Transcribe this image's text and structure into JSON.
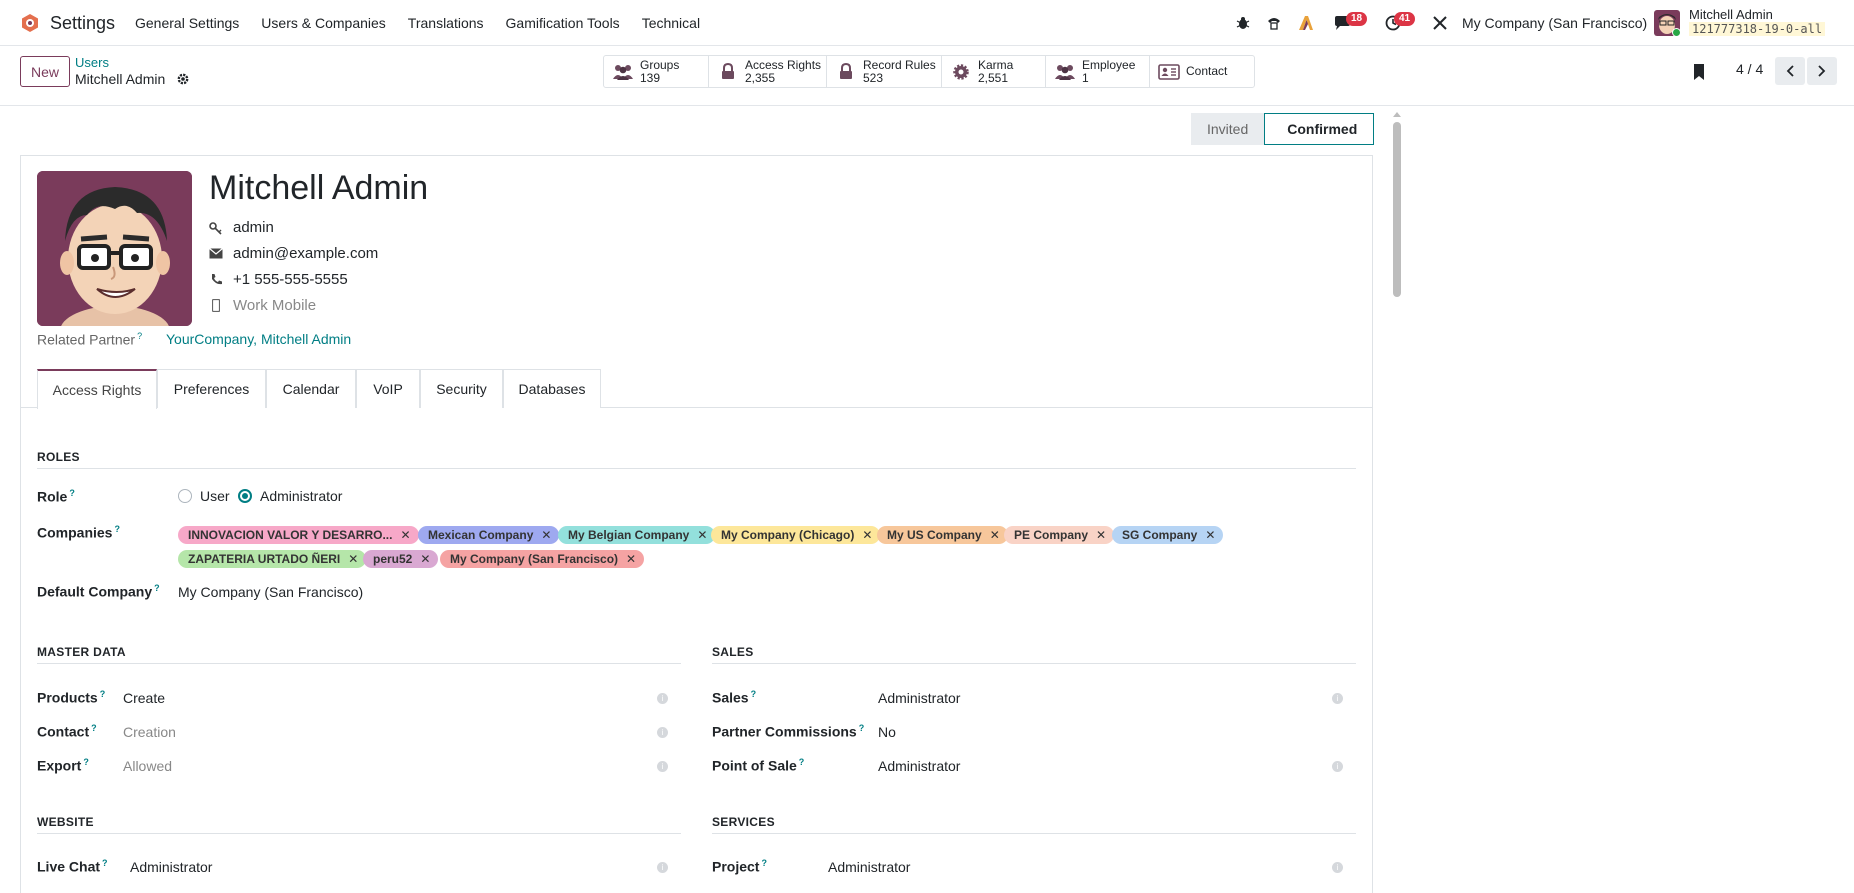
{
  "navbar": {
    "app_name": "Settings",
    "menu": [
      "General Settings",
      "Users & Companies",
      "Translations",
      "Gamification Tools",
      "Technical"
    ],
    "messages_badge": "18",
    "activities_badge": "41",
    "company": "My Company (San Francisco)",
    "user_name": "Mitchell Admin",
    "database": "121777318-19-0-all"
  },
  "control_panel": {
    "new_label": "New",
    "breadcrumb_parent": "Users",
    "breadcrumb_current": "Mitchell Admin",
    "smart_buttons": [
      {
        "label": "Groups",
        "value": "139",
        "icon": "users-icon"
      },
      {
        "label": "Access Rights",
        "value": "2,355",
        "icon": "lock-icon"
      },
      {
        "label": "Record Rules",
        "value": "523",
        "icon": "lock-icon"
      },
      {
        "label": "Karma",
        "value": "2,551",
        "icon": "karma-icon"
      },
      {
        "label": "Employee",
        "value": "1",
        "icon": "users-icon"
      },
      {
        "label": "Contact",
        "value": "",
        "icon": "contact-card-icon"
      }
    ],
    "pager": "4 / 4"
  },
  "statusbar": {
    "steps": [
      "Invited",
      "Confirmed"
    ],
    "current": "Confirmed"
  },
  "record": {
    "name": "Mitchell Admin",
    "login": "admin",
    "email": "admin@example.com",
    "phone": "+1 555-555-5555",
    "mobile_placeholder": "Work Mobile",
    "related_partner_label": "Related Partner",
    "related_partner": "YourCompany, Mitchell Admin"
  },
  "tabs": [
    "Access Rights",
    "Preferences",
    "Calendar",
    "VoIP",
    "Security",
    "Databases"
  ],
  "roles": {
    "section": "ROLES",
    "role_label": "Role",
    "role_options": [
      "User",
      "Administrator"
    ],
    "role_selected": "Administrator",
    "companies_label": "Companies",
    "companies": [
      {
        "name": "INNOVACION VALOR Y DESARRO...",
        "color": "#f7a8c8"
      },
      {
        "name": "Mexican Company",
        "color": "#9ea9f0"
      },
      {
        "name": "My Belgian Company",
        "color": "#93e0dc"
      },
      {
        "name": "My Company (Chicago)",
        "color": "#fde79a"
      },
      {
        "name": "My US Company",
        "color": "#f7c79b"
      },
      {
        "name": "PE Company",
        "color": "#f9d3c6"
      },
      {
        "name": "SG Company",
        "color": "#b6d4f4"
      },
      {
        "name": "ZAPATERIA URTADO ÑERI",
        "color": "#b5e6a9"
      },
      {
        "name": "peru52",
        "color": "#d9a8d2"
      },
      {
        "name": "My Company (San Francisco)",
        "color": "#f5a3a3"
      }
    ],
    "default_company_label": "Default Company",
    "default_company": "My Company (San Francisco)"
  },
  "master_data": {
    "section": "MASTER DATA",
    "rows": [
      {
        "label": "Products",
        "value": "Create",
        "muted": false
      },
      {
        "label": "Contact",
        "value": "Creation",
        "muted": true
      },
      {
        "label": "Export",
        "value": "Allowed",
        "muted": true
      }
    ]
  },
  "sales": {
    "section": "SALES",
    "rows": [
      {
        "label": "Sales",
        "value": "Administrator"
      },
      {
        "label": "Partner Commissions",
        "value": "No"
      },
      {
        "label": "Point of Sale",
        "value": "Administrator"
      }
    ]
  },
  "website": {
    "section": "WEBSITE",
    "rows": [
      {
        "label": "Live Chat",
        "value": "Administrator"
      }
    ]
  },
  "services": {
    "section": "SERVICES",
    "rows": [
      {
        "label": "Project",
        "value": "Administrator"
      }
    ]
  }
}
